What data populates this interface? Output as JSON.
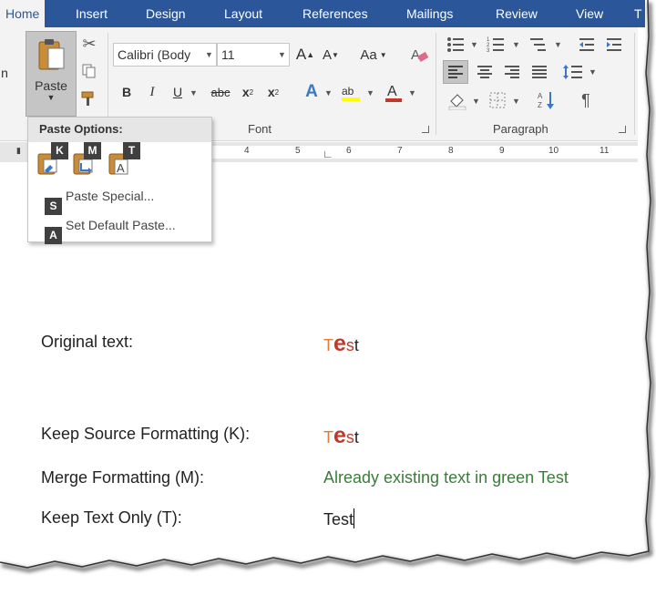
{
  "tabs": [
    "Home",
    "Insert",
    "Design",
    "Layout",
    "References",
    "Mailings",
    "Review",
    "View",
    "T"
  ],
  "ribbon": {
    "paste_label": "Paste",
    "font_name": "Calibri (Body",
    "font_size": "11",
    "case_label": "Aa",
    "bold": "B",
    "italic": "I",
    "underline": "U",
    "strike": "abc",
    "subscript": "x",
    "superscript": "x",
    "font_group_label": "Font",
    "paragraph_group_label": "Paragraph",
    "pilcrow": "¶"
  },
  "ruler": {
    "ticks": [
      "4",
      "5",
      "6",
      "7",
      "8",
      "9",
      "10",
      "11"
    ]
  },
  "paste_menu": {
    "title": "Paste Options:",
    "keytips": [
      "K",
      "M",
      "T"
    ],
    "items": [
      {
        "key": "S",
        "label": "Paste Special..."
      },
      {
        "key": "A",
        "label": "Set Default Paste..."
      }
    ]
  },
  "document": {
    "rows": [
      {
        "label": "Original text:",
        "parts": [
          "T",
          "e",
          "s",
          "t"
        ]
      },
      {
        "label": "Keep Source Formatting (K):",
        "parts": [
          "T",
          "e",
          "s",
          "t"
        ]
      },
      {
        "label": "Merge Formatting (M):",
        "value": "Already existing text in green Test"
      },
      {
        "label": "Keep Text Only (T):",
        "value": "Test"
      }
    ]
  },
  "colors": {
    "accent": "#2b579a",
    "red_text": "#c0392b",
    "orange_text": "#e07b39",
    "green_text": "#3a7d3a"
  }
}
